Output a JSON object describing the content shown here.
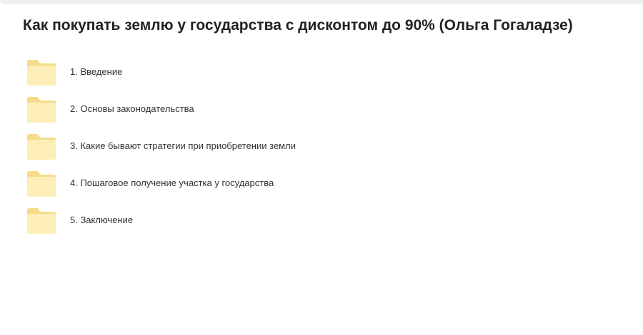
{
  "folder": {
    "title": "Как покупать землю у государства с дисконтом до 90% (Ольга Гогаладзе)",
    "items": [
      {
        "name": "1. Введение",
        "icon": "folder-icon"
      },
      {
        "name": "2. Основы законодательства",
        "icon": "folder-icon"
      },
      {
        "name": "3. Какие бывают стратегии при приобретении земли",
        "icon": "folder-icon"
      },
      {
        "name": "4. Пошаговое получение участка у государства",
        "icon": "folder-icon"
      },
      {
        "name": "5. Заключение",
        "icon": "folder-icon"
      }
    ]
  },
  "colors": {
    "folder_back": "#fbe7a4",
    "folder_front": "#fdf0c2",
    "text": "#333333"
  }
}
